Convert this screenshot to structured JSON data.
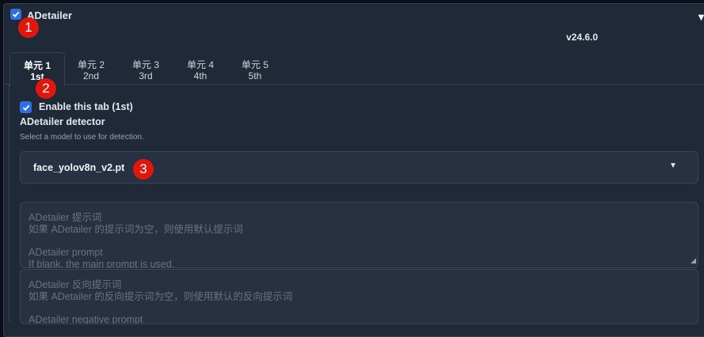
{
  "header": {
    "title": "ADetailer",
    "checked": true,
    "version": "v24.6.0",
    "collapse_icon": "▼"
  },
  "tabs": [
    {
      "label": "单元 1",
      "sub": "1st",
      "active": true
    },
    {
      "label": "单元 2",
      "sub": "2nd",
      "active": false
    },
    {
      "label": "单元 3",
      "sub": "3rd",
      "active": false
    },
    {
      "label": "单元 4",
      "sub": "4th",
      "active": false
    },
    {
      "label": "单元 5",
      "sub": "5th",
      "active": false
    }
  ],
  "enable": {
    "label": "Enable this tab (1st)",
    "checked": true
  },
  "detector": {
    "label": "ADetailer detector",
    "info": "Select a model to use for detection.",
    "value": "face_yolov8n_v2.pt",
    "arrow_icon": "▼"
  },
  "prompt": {
    "zh_title": "ADetailer 提示词",
    "zh_desc": "如果 ADetailer 的提示词为空，则使用默认提示词",
    "en_title": "ADetailer prompt",
    "en_desc": "If blank, the main prompt is used."
  },
  "negative_prompt": {
    "zh_title": "ADetailer 反向提示词",
    "zh_desc": "如果 ADetailer 的反向提示词为空，则使用默认的反向提示词",
    "en_title": "ADetailer negative prompt"
  },
  "badges": [
    "1",
    "2",
    "3"
  ],
  "colors": {
    "accent": "#2f6fe0",
    "badge": "#e1170c",
    "background": "#0b0f19",
    "panel": "#1f2937"
  }
}
